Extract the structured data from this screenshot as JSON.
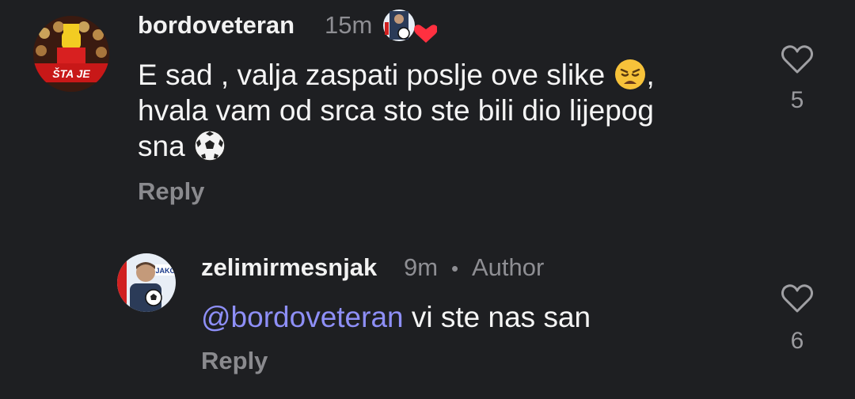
{
  "comments": [
    {
      "username": "bordoveteran",
      "time": "15m",
      "text_line1": "E sad , valja zaspati poslje ove slike",
      "text_line1_tail": ",",
      "text_line2": "hvala vam od srca sto ste bili dio lijepog",
      "text_line3": "sna",
      "reply_label": "Reply",
      "like_count": "5",
      "avatar_text": "ŠTA JE",
      "emoji_1": "weary-face-icon",
      "emoji_2": "soccer-ball-icon"
    },
    {
      "username": "zelimirmesnjak",
      "time": "9m",
      "separator": "•",
      "author_badge": "Author",
      "mention": "@bordoveteran",
      "text": "vi ste nas san",
      "reply_label": "Reply",
      "like_count": "6",
      "avatar_text": "JAKO"
    }
  ],
  "colors": {
    "background": "#1e1f22",
    "mention": "#8e8ff7",
    "muted": "#8e8e93",
    "heart_red": "#ff3040"
  }
}
